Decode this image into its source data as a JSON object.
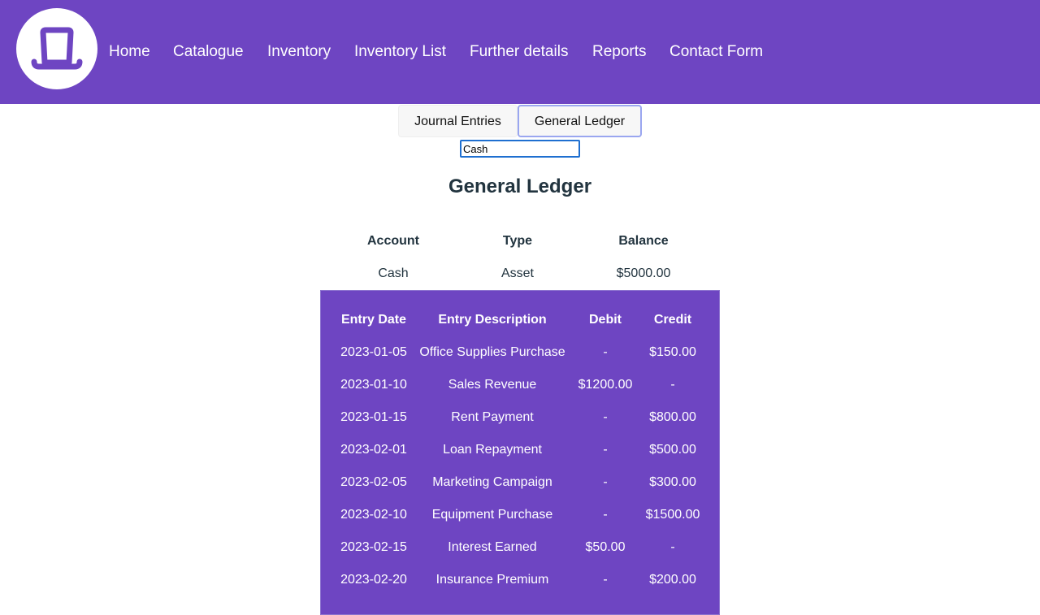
{
  "nav": {
    "logo_icon": "top-hat-icon",
    "items": [
      {
        "label": "Home"
      },
      {
        "label": "Catalogue"
      },
      {
        "label": "Inventory"
      },
      {
        "label": "Inventory List"
      },
      {
        "label": "Further details"
      },
      {
        "label": "Reports"
      },
      {
        "label": "Contact Form"
      }
    ]
  },
  "tabs": [
    {
      "label": "Journal Entries",
      "active": false
    },
    {
      "label": "General Ledger",
      "active": true
    }
  ],
  "account_filter": {
    "value": "Cash"
  },
  "page_title": "General Ledger",
  "summary": {
    "headers": {
      "account": "Account",
      "type": "Type",
      "balance": "Balance"
    },
    "row": {
      "account": "Cash",
      "type": "Asset",
      "balance": "$5000.00"
    }
  },
  "ledger": {
    "headers": {
      "date": "Entry Date",
      "description": "Entry Description",
      "debit": "Debit",
      "credit": "Credit"
    },
    "rows": [
      {
        "date": "2023-01-05",
        "description": "Office Supplies Purchase",
        "debit": "-",
        "credit": "$150.00"
      },
      {
        "date": "2023-01-10",
        "description": "Sales Revenue",
        "debit": "$1200.00",
        "credit": "-"
      },
      {
        "date": "2023-01-15",
        "description": "Rent Payment",
        "debit": "-",
        "credit": "$800.00"
      },
      {
        "date": "2023-02-01",
        "description": "Loan Repayment",
        "debit": "-",
        "credit": "$500.00"
      },
      {
        "date": "2023-02-05",
        "description": "Marketing Campaign",
        "debit": "-",
        "credit": "$300.00"
      },
      {
        "date": "2023-02-10",
        "description": "Equipment Purchase",
        "debit": "-",
        "credit": "$1500.00"
      },
      {
        "date": "2023-02-15",
        "description": "Interest Earned",
        "debit": "$50.00",
        "credit": "-"
      },
      {
        "date": "2023-02-20",
        "description": "Insurance Premium",
        "debit": "-",
        "credit": "$200.00"
      }
    ]
  },
  "colors": {
    "brand": "#6e45c2",
    "heading": "#22343f",
    "input_focus": "#1f6fd0"
  }
}
